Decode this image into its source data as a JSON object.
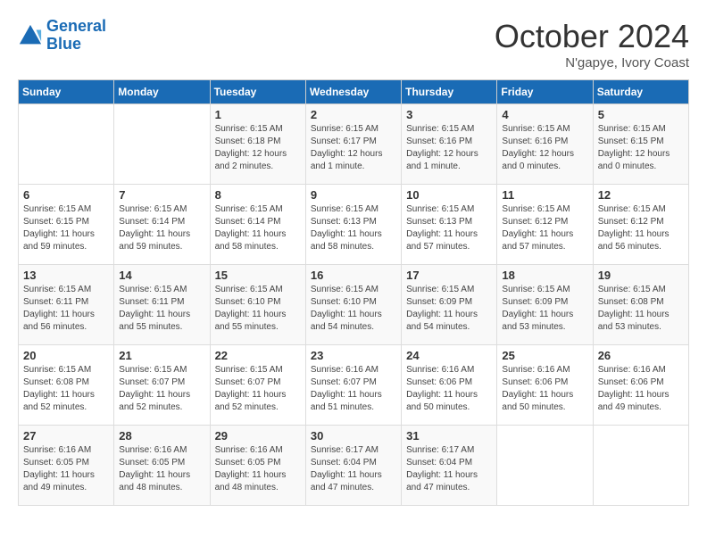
{
  "logo": {
    "line1": "General",
    "line2": "Blue"
  },
  "title": "October 2024",
  "location": "N'gapye, Ivory Coast",
  "header": {
    "days": [
      "Sunday",
      "Monday",
      "Tuesday",
      "Wednesday",
      "Thursday",
      "Friday",
      "Saturday"
    ]
  },
  "weeks": [
    [
      {
        "day": "",
        "info": ""
      },
      {
        "day": "",
        "info": ""
      },
      {
        "day": "1",
        "info": "Sunrise: 6:15 AM\nSunset: 6:18 PM\nDaylight: 12 hours\nand 2 minutes."
      },
      {
        "day": "2",
        "info": "Sunrise: 6:15 AM\nSunset: 6:17 PM\nDaylight: 12 hours\nand 1 minute."
      },
      {
        "day": "3",
        "info": "Sunrise: 6:15 AM\nSunset: 6:16 PM\nDaylight: 12 hours\nand 1 minute."
      },
      {
        "day": "4",
        "info": "Sunrise: 6:15 AM\nSunset: 6:16 PM\nDaylight: 12 hours\nand 0 minutes."
      },
      {
        "day": "5",
        "info": "Sunrise: 6:15 AM\nSunset: 6:15 PM\nDaylight: 12 hours\nand 0 minutes."
      }
    ],
    [
      {
        "day": "6",
        "info": "Sunrise: 6:15 AM\nSunset: 6:15 PM\nDaylight: 11 hours\nand 59 minutes."
      },
      {
        "day": "7",
        "info": "Sunrise: 6:15 AM\nSunset: 6:14 PM\nDaylight: 11 hours\nand 59 minutes."
      },
      {
        "day": "8",
        "info": "Sunrise: 6:15 AM\nSunset: 6:14 PM\nDaylight: 11 hours\nand 58 minutes."
      },
      {
        "day": "9",
        "info": "Sunrise: 6:15 AM\nSunset: 6:13 PM\nDaylight: 11 hours\nand 58 minutes."
      },
      {
        "day": "10",
        "info": "Sunrise: 6:15 AM\nSunset: 6:13 PM\nDaylight: 11 hours\nand 57 minutes."
      },
      {
        "day": "11",
        "info": "Sunrise: 6:15 AM\nSunset: 6:12 PM\nDaylight: 11 hours\nand 57 minutes."
      },
      {
        "day": "12",
        "info": "Sunrise: 6:15 AM\nSunset: 6:12 PM\nDaylight: 11 hours\nand 56 minutes."
      }
    ],
    [
      {
        "day": "13",
        "info": "Sunrise: 6:15 AM\nSunset: 6:11 PM\nDaylight: 11 hours\nand 56 minutes."
      },
      {
        "day": "14",
        "info": "Sunrise: 6:15 AM\nSunset: 6:11 PM\nDaylight: 11 hours\nand 55 minutes."
      },
      {
        "day": "15",
        "info": "Sunrise: 6:15 AM\nSunset: 6:10 PM\nDaylight: 11 hours\nand 55 minutes."
      },
      {
        "day": "16",
        "info": "Sunrise: 6:15 AM\nSunset: 6:10 PM\nDaylight: 11 hours\nand 54 minutes."
      },
      {
        "day": "17",
        "info": "Sunrise: 6:15 AM\nSunset: 6:09 PM\nDaylight: 11 hours\nand 54 minutes."
      },
      {
        "day": "18",
        "info": "Sunrise: 6:15 AM\nSunset: 6:09 PM\nDaylight: 11 hours\nand 53 minutes."
      },
      {
        "day": "19",
        "info": "Sunrise: 6:15 AM\nSunset: 6:08 PM\nDaylight: 11 hours\nand 53 minutes."
      }
    ],
    [
      {
        "day": "20",
        "info": "Sunrise: 6:15 AM\nSunset: 6:08 PM\nDaylight: 11 hours\nand 52 minutes."
      },
      {
        "day": "21",
        "info": "Sunrise: 6:15 AM\nSunset: 6:07 PM\nDaylight: 11 hours\nand 52 minutes."
      },
      {
        "day": "22",
        "info": "Sunrise: 6:15 AM\nSunset: 6:07 PM\nDaylight: 11 hours\nand 52 minutes."
      },
      {
        "day": "23",
        "info": "Sunrise: 6:16 AM\nSunset: 6:07 PM\nDaylight: 11 hours\nand 51 minutes."
      },
      {
        "day": "24",
        "info": "Sunrise: 6:16 AM\nSunset: 6:06 PM\nDaylight: 11 hours\nand 50 minutes."
      },
      {
        "day": "25",
        "info": "Sunrise: 6:16 AM\nSunset: 6:06 PM\nDaylight: 11 hours\nand 50 minutes."
      },
      {
        "day": "26",
        "info": "Sunrise: 6:16 AM\nSunset: 6:06 PM\nDaylight: 11 hours\nand 49 minutes."
      }
    ],
    [
      {
        "day": "27",
        "info": "Sunrise: 6:16 AM\nSunset: 6:05 PM\nDaylight: 11 hours\nand 49 minutes."
      },
      {
        "day": "28",
        "info": "Sunrise: 6:16 AM\nSunset: 6:05 PM\nDaylight: 11 hours\nand 48 minutes."
      },
      {
        "day": "29",
        "info": "Sunrise: 6:16 AM\nSunset: 6:05 PM\nDaylight: 11 hours\nand 48 minutes."
      },
      {
        "day": "30",
        "info": "Sunrise: 6:17 AM\nSunset: 6:04 PM\nDaylight: 11 hours\nand 47 minutes."
      },
      {
        "day": "31",
        "info": "Sunrise: 6:17 AM\nSunset: 6:04 PM\nDaylight: 11 hours\nand 47 minutes."
      },
      {
        "day": "",
        "info": ""
      },
      {
        "day": "",
        "info": ""
      }
    ]
  ]
}
